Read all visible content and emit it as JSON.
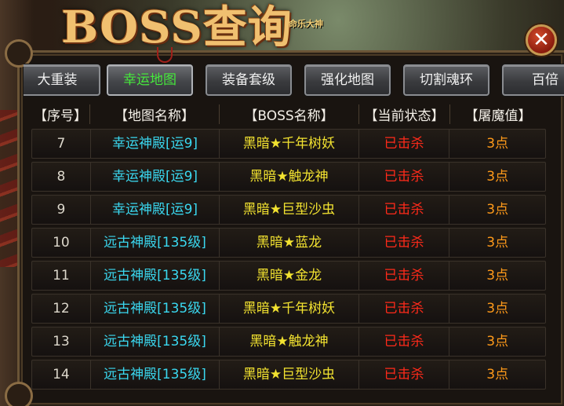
{
  "window": {
    "title": "BOSS查询",
    "subtitle": "命乐大神",
    "close_glyph": "✕"
  },
  "tabs": [
    {
      "label": "大重装",
      "active": false
    },
    {
      "label": "幸运地图",
      "active": true
    },
    {
      "label": "装备套级",
      "active": false
    },
    {
      "label": "强化地图",
      "active": false
    },
    {
      "label": "切割魂环",
      "active": false
    },
    {
      "label": "百倍",
      "active": false
    }
  ],
  "table": {
    "headers": [
      "【序号】",
      "【地图名称】",
      "【BOSS名称】",
      "【当前状态】",
      "【屠魔值】"
    ],
    "rows": [
      {
        "no": "7",
        "map": "幸运神殿[运9]",
        "boss": "黑暗★千年树妖",
        "status": "已击杀",
        "value": "3点"
      },
      {
        "no": "8",
        "map": "幸运神殿[运9]",
        "boss": "黑暗★触龙神",
        "status": "已击杀",
        "value": "3点"
      },
      {
        "no": "9",
        "map": "幸运神殿[运9]",
        "boss": "黑暗★巨型沙虫",
        "status": "已击杀",
        "value": "3点"
      },
      {
        "no": "10",
        "map": "远古神殿[135级]",
        "boss": "黑暗★蓝龙",
        "status": "已击杀",
        "value": "3点"
      },
      {
        "no": "11",
        "map": "远古神殿[135级]",
        "boss": "黑暗★金龙",
        "status": "已击杀",
        "value": "3点"
      },
      {
        "no": "12",
        "map": "远古神殿[135级]",
        "boss": "黑暗★千年树妖",
        "status": "已击杀",
        "value": "3点"
      },
      {
        "no": "13",
        "map": "远古神殿[135级]",
        "boss": "黑暗★触龙神",
        "status": "已击杀",
        "value": "3点"
      },
      {
        "no": "14",
        "map": "远古神殿[135级]",
        "boss": "黑暗★巨型沙虫",
        "status": "已击杀",
        "value": "3点"
      }
    ]
  },
  "colors": {
    "tab_active_text": "#46e83c",
    "map_name": "#3ad8f0",
    "boss_name": "#f2e230",
    "status_killed": "#ff2a1a",
    "value": "#ff9a1a"
  }
}
